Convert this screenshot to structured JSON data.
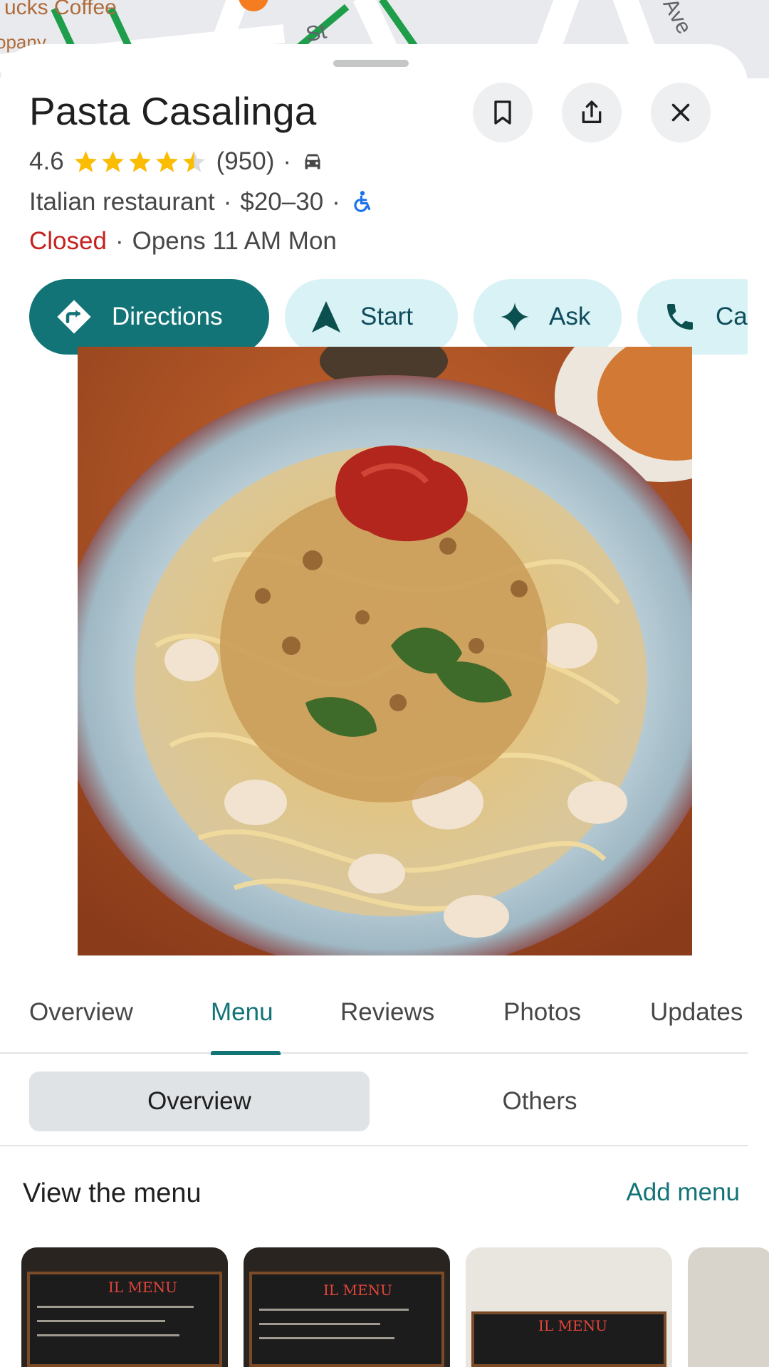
{
  "map": {
    "labels": [
      "ucks Coffee",
      "St",
      "Ave",
      "opany"
    ]
  },
  "place": {
    "name": "Pasta Casalinga",
    "rating": "4.6",
    "stars": 4.5,
    "review_count": "(950)",
    "category": "Italian restaurant",
    "price": "$20–30",
    "status": "Closed",
    "hours": "Opens 11 AM Mon",
    "separator": "·"
  },
  "header_buttons": {
    "save_icon": "bookmark-icon",
    "share_icon": "share-icon",
    "close_icon": "close-icon"
  },
  "actions": [
    {
      "label": "Directions",
      "icon": "directions-icon"
    },
    {
      "label": "Start",
      "icon": "navigation-arrow-icon"
    },
    {
      "label": "Ask",
      "icon": "sparkle-icon"
    },
    {
      "label": "Ca",
      "icon": "phone-icon"
    }
  ],
  "tabs": [
    "Overview",
    "Menu",
    "Reviews",
    "Photos",
    "Updates"
  ],
  "active_tab": "Menu",
  "menu_segments": [
    "Overview",
    "Others"
  ],
  "menu_section": {
    "title": "View the menu",
    "add_label": "Add menu"
  },
  "thumb_text": [
    "IL MENU",
    "IL MENU",
    "IL MENU"
  ],
  "colors": {
    "accent": "#137477",
    "closed": "#c5221f",
    "star": "#fbbc04",
    "pill_bg": "#d8f2f5"
  }
}
